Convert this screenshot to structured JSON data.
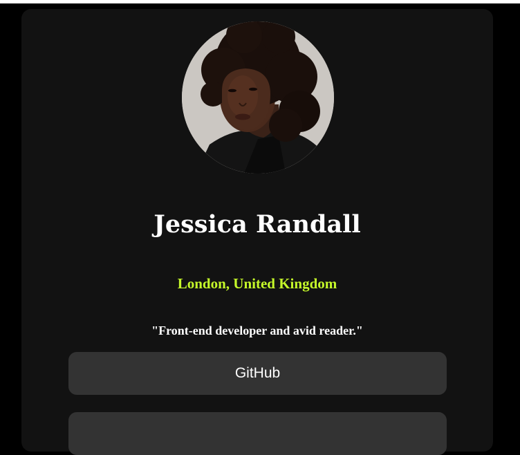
{
  "profile": {
    "name": "Jessica Randall",
    "location": "London, United Kingdom",
    "bio": "\"Front-end developer and avid reader.\"",
    "avatar_alt": "profile photo"
  },
  "links": [
    {
      "label": "GitHub"
    },
    {
      "label": ""
    }
  ],
  "colors": {
    "background": "#000000",
    "card": "#121212",
    "button": "#333333",
    "accent": "#c5f82a",
    "text": "#ffffff"
  }
}
